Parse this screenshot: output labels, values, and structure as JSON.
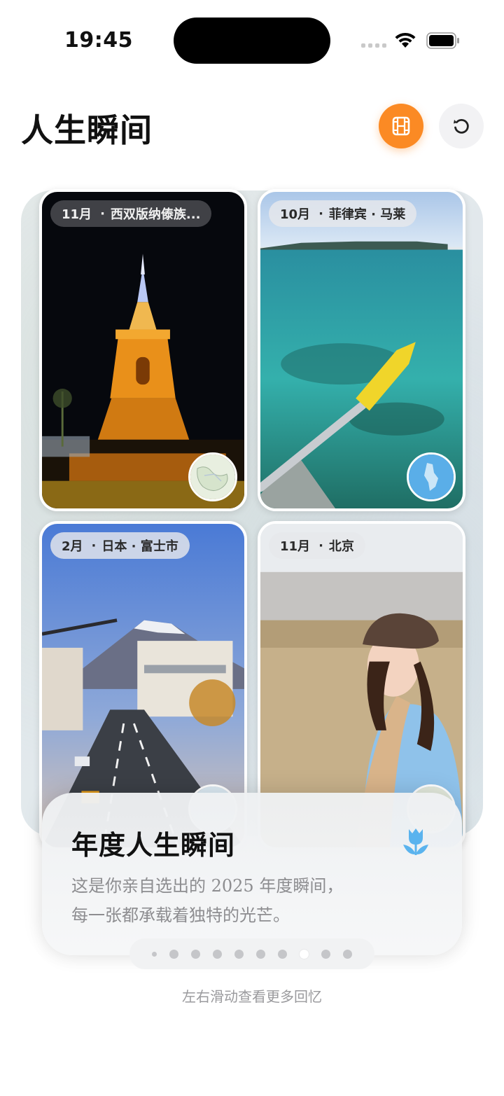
{
  "status_bar": {
    "time": "19:45"
  },
  "header": {
    "title": "人生瞬间",
    "film_icon": "film-icon",
    "reset_icon": "rotate-ccw-icon",
    "accent_color": "#FB8A24"
  },
  "photos": [
    {
      "month": "11月",
      "place": "西双版纳傣族...",
      "scene": "night golden pagoda"
    },
    {
      "month": "10月",
      "place": "菲律宾 · 马莱",
      "scene": "turquoise sea with yellow kayak paddle"
    },
    {
      "month": "2月",
      "place": "日本 · 富士市",
      "scene": "mount fuji over city street"
    },
    {
      "month": "11月",
      "place": "北京",
      "scene": "woman with beret in reed field"
    }
  ],
  "info_card": {
    "title": "年度人生瞬间",
    "icon": "tulip-icon",
    "icon_color": "#5AB3EE",
    "desc_line1": "这是你亲自选出的 2025 年度瞬间，",
    "desc_line2": "每一张都承载着独特的光芒。"
  },
  "pager": {
    "total": 10,
    "active_index": 7
  },
  "hint": "左右滑动查看更多回忆"
}
